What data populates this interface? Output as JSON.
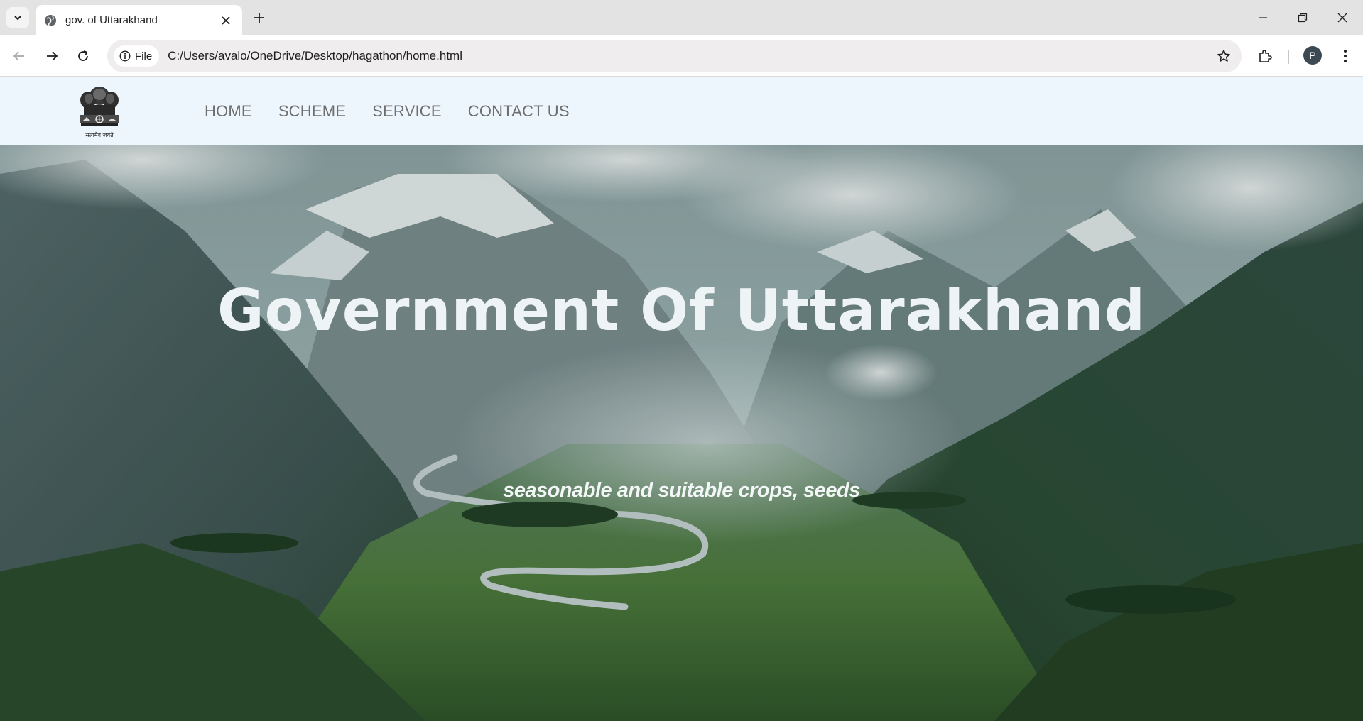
{
  "browser": {
    "tab_title": "gov. of Uttarakhand",
    "file_chip_label": "File",
    "url": "C:/Users/avalo/OneDrive/Desktop/hagathon/home.html",
    "profile_initial": "P"
  },
  "site": {
    "nav": {
      "items": [
        {
          "label": "HOME"
        },
        {
          "label": "SCHEME"
        },
        {
          "label": "SERVICE"
        },
        {
          "label": "CONTACT US"
        }
      ]
    },
    "emblem_motto": "सत्यमेव जयते",
    "hero": {
      "title": "Government Of Uttarakhand",
      "subtitle": "seasonable and suitable crops, seeds"
    }
  },
  "colors": {
    "nav_background": "#edf5fd",
    "nav_text": "#6e6e6e",
    "hero_text": "#eef3f5"
  },
  "icons": [
    "tab-search-icon",
    "globe-icon",
    "close-icon",
    "plus-icon",
    "minimize-icon",
    "restore-icon",
    "window-close-icon",
    "back-arrow-icon",
    "forward-arrow-icon",
    "reload-icon",
    "info-icon",
    "star-icon",
    "extensions-icon",
    "kebab-menu-icon",
    "national-emblem-logo"
  ]
}
